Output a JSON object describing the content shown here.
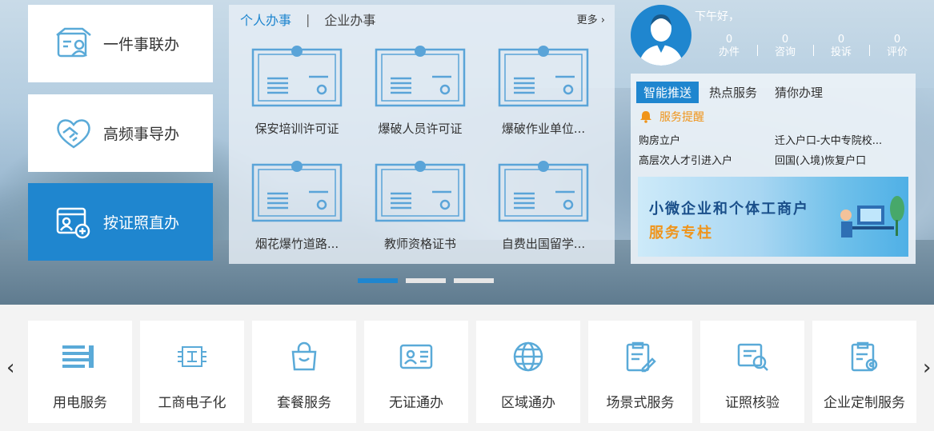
{
  "left_tiles": [
    {
      "label": "一件事联办",
      "icon": "people-box-icon"
    },
    {
      "label": "高频事导办",
      "icon": "handshake-icon"
    },
    {
      "label": "按证照直办",
      "icon": "id-card-add-icon"
    }
  ],
  "middle": {
    "tabs": [
      "个人办事",
      "企业办事"
    ],
    "more_label": "更多",
    "cards": [
      "保安培训许可证",
      "爆破人员许可证",
      "爆破作业单位...",
      "烟花爆竹道路...",
      "教师资格证书",
      "自费出国留学..."
    ]
  },
  "user": {
    "greeting": "下午好，",
    "stats": [
      {
        "value": "0",
        "label": "办件"
      },
      {
        "value": "0",
        "label": "咨询"
      },
      {
        "value": "0",
        "label": "投诉"
      },
      {
        "value": "0",
        "label": "评价"
      }
    ]
  },
  "right_panel": {
    "tabs": [
      "智能推送",
      "热点服务",
      "猜你办理"
    ],
    "reminder": "服务提醒",
    "links": [
      [
        "购房立户",
        "迁入户口-大中专院校..."
      ],
      [
        "高层次人才引进入户",
        "回国(入境)恢复户口"
      ]
    ],
    "banner_line1": "小微企业和个体工商户",
    "banner_line2": "服务专柱"
  },
  "services": [
    {
      "label": "用电服务",
      "icon": "power-lines-icon"
    },
    {
      "label": "工商电子化",
      "icon": "chip-icon"
    },
    {
      "label": "套餐服务",
      "icon": "shopping-bag-icon"
    },
    {
      "label": "无证通办",
      "icon": "id-card-icon"
    },
    {
      "label": "区域通办",
      "icon": "globe-icon"
    },
    {
      "label": "场景式服务",
      "icon": "clipboard-pen-icon"
    },
    {
      "label": "证照核验",
      "icon": "certificate-search-icon"
    },
    {
      "label": "企业定制服务",
      "icon": "clipboard-gear-icon"
    }
  ],
  "nav": {
    "prev": "‹",
    "next": "›"
  },
  "colors": {
    "accent": "#1f86cf",
    "icon": "#5aaad8",
    "reminder": "#f0941a"
  }
}
